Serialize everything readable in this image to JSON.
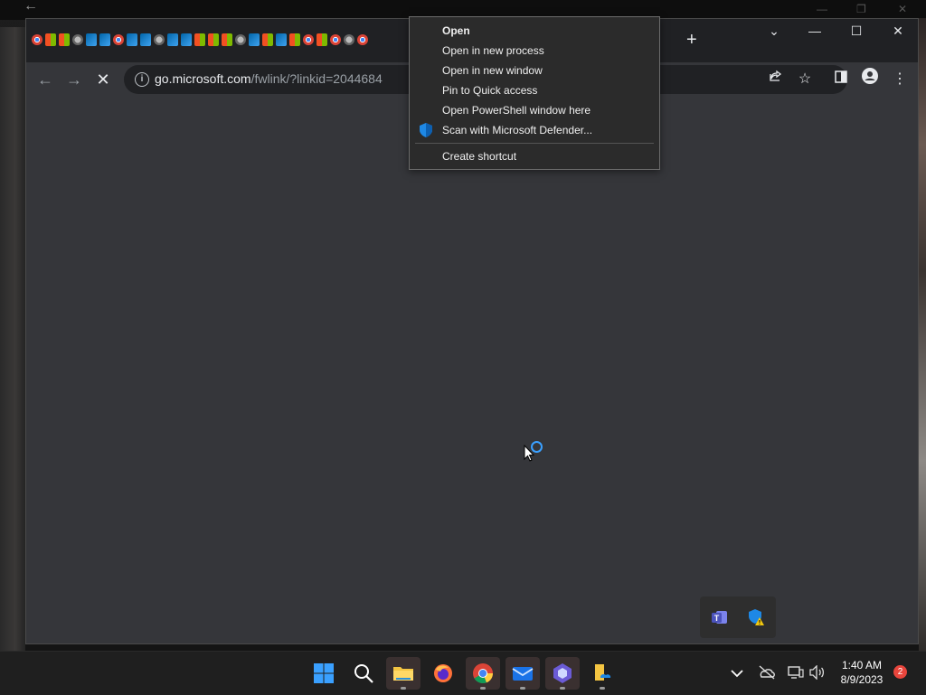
{
  "browser": {
    "url_host": "go.microsoft.com",
    "url_path": "/fwlink/?linkid=2044684",
    "tab_strip": {
      "favicons": [
        "chrome",
        "ms",
        "ms",
        "globe",
        "vs",
        "vs",
        "chrome",
        "vs",
        "vs",
        "globe",
        "vs",
        "vs",
        "ms",
        "ms",
        "ms",
        "globe",
        "vs",
        "ms",
        "vs",
        "ms",
        "chrome",
        "ms",
        "chrome",
        "globe",
        "chrome"
      ]
    },
    "new_tab": "+",
    "window_controls": {
      "tab_search": "⌄",
      "minimize": "—",
      "maximize": "☐",
      "close": "✕"
    }
  },
  "context_menu": {
    "items": [
      {
        "label": "Open",
        "bold": true
      },
      {
        "label": "Open in new process"
      },
      {
        "label": "Open in new window"
      },
      {
        "label": "Pin to Quick access"
      },
      {
        "label": "Open PowerShell window here"
      },
      {
        "label": "Scan with Microsoft Defender...",
        "icon": "defender-shield-icon"
      },
      {
        "label": "Create shortcut"
      }
    ]
  },
  "taskbar": {
    "apps": [
      "start",
      "search",
      "file-explorer",
      "firefox",
      "chrome",
      "mail",
      "copilot",
      "onedrive-folder"
    ],
    "clock": {
      "time": "1:40 AM",
      "date": "8/9/2023"
    },
    "notification_count": "2"
  },
  "colors": {
    "accent": "#3aa0ff",
    "badge": "#e8453c"
  }
}
